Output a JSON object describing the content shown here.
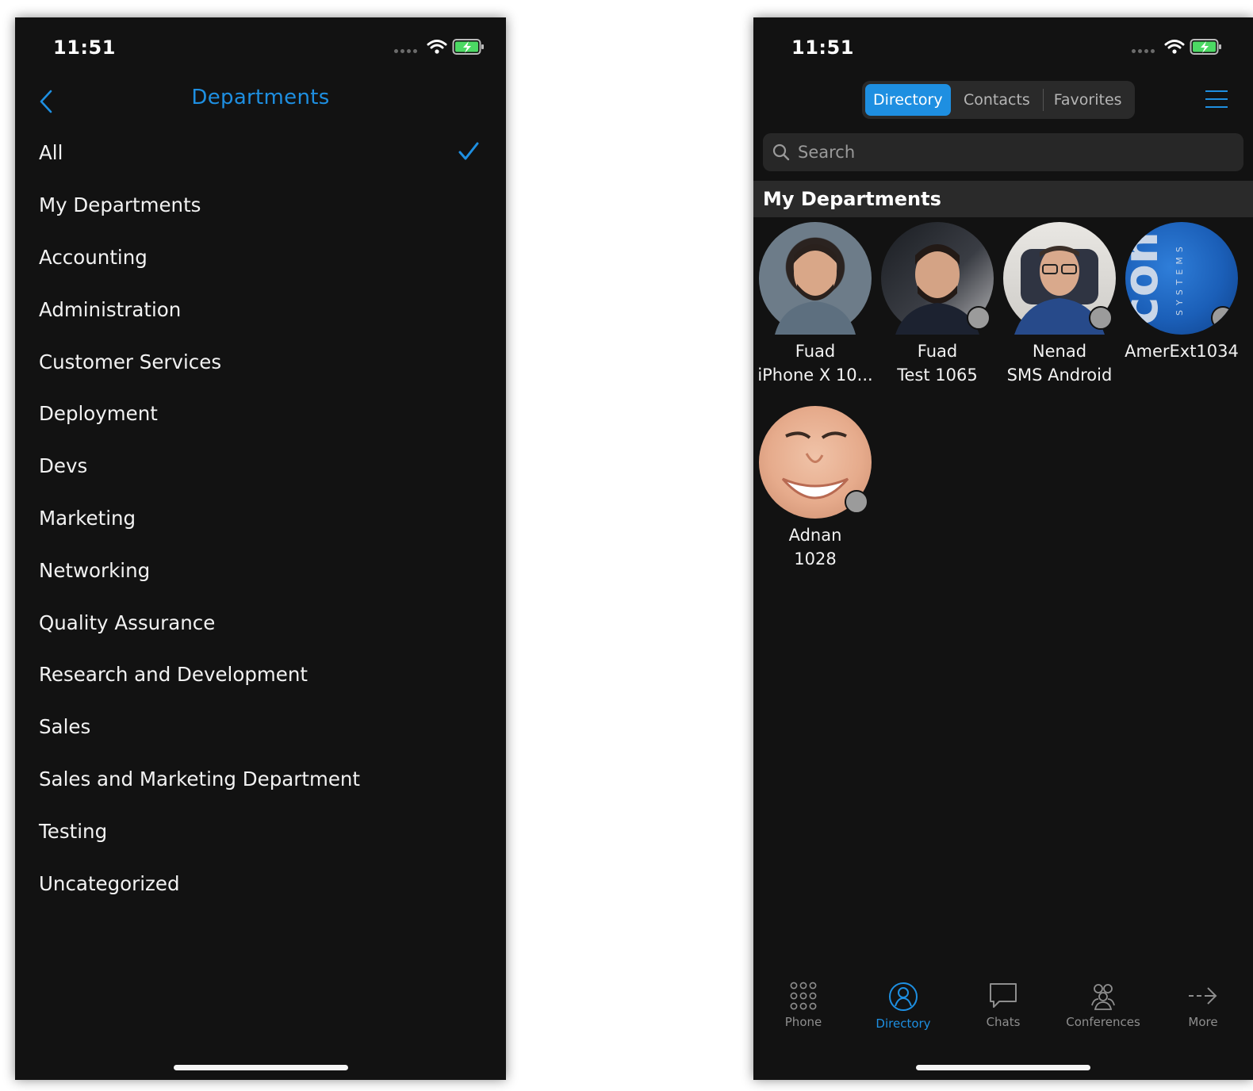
{
  "colors": {
    "accent": "#1e8fe1",
    "background": "#121212",
    "presence_offline": "#9b9b9b",
    "battery": "#4cd964"
  },
  "left_screen": {
    "status_time": "11:51",
    "nav_title": "Departments",
    "back_icon": "chevron-left-icon",
    "departments": [
      {
        "label": "All",
        "selected": true
      },
      {
        "label": "My Departments"
      },
      {
        "label": "Accounting"
      },
      {
        "label": "Administration"
      },
      {
        "label": "Customer Services"
      },
      {
        "label": "Deployment"
      },
      {
        "label": "Devs"
      },
      {
        "label": "Marketing"
      },
      {
        "label": "Networking"
      },
      {
        "label": "Quality Assurance"
      },
      {
        "label": "Research and Development"
      },
      {
        "label": "Sales"
      },
      {
        "label": "Sales and Marketing Department"
      },
      {
        "label": "Testing"
      },
      {
        "label": "Uncategorized"
      }
    ]
  },
  "right_screen": {
    "status_time": "11:51",
    "tabs": [
      {
        "label": "Directory",
        "active": true
      },
      {
        "label": "Contacts"
      },
      {
        "label": "Favorites"
      }
    ],
    "search": {
      "placeholder": "Search",
      "value": ""
    },
    "section_title": "My Departments",
    "contacts": [
      {
        "line1": "Fuad",
        "line2": "iPhone X 10...",
        "presence": "online"
      },
      {
        "line1": "Fuad",
        "line2": "Test 1065",
        "presence": "offline"
      },
      {
        "line1": "Nenad",
        "line2": "SMS Android",
        "presence": "offline"
      },
      {
        "line1": "AmerExt1034",
        "line2": "",
        "presence": "offline"
      },
      {
        "line1": "Adnan",
        "line2": "1028",
        "presence": "offline"
      }
    ],
    "bottom_tabs": [
      {
        "label": "Phone",
        "icon": "dialpad-icon"
      },
      {
        "label": "Directory",
        "icon": "person-icon",
        "active": true
      },
      {
        "label": "Chats",
        "icon": "chat-bubble-icon"
      },
      {
        "label": "Conferences",
        "icon": "people-group-icon"
      },
      {
        "label": "More",
        "icon": "arrow-right-icon"
      }
    ]
  }
}
